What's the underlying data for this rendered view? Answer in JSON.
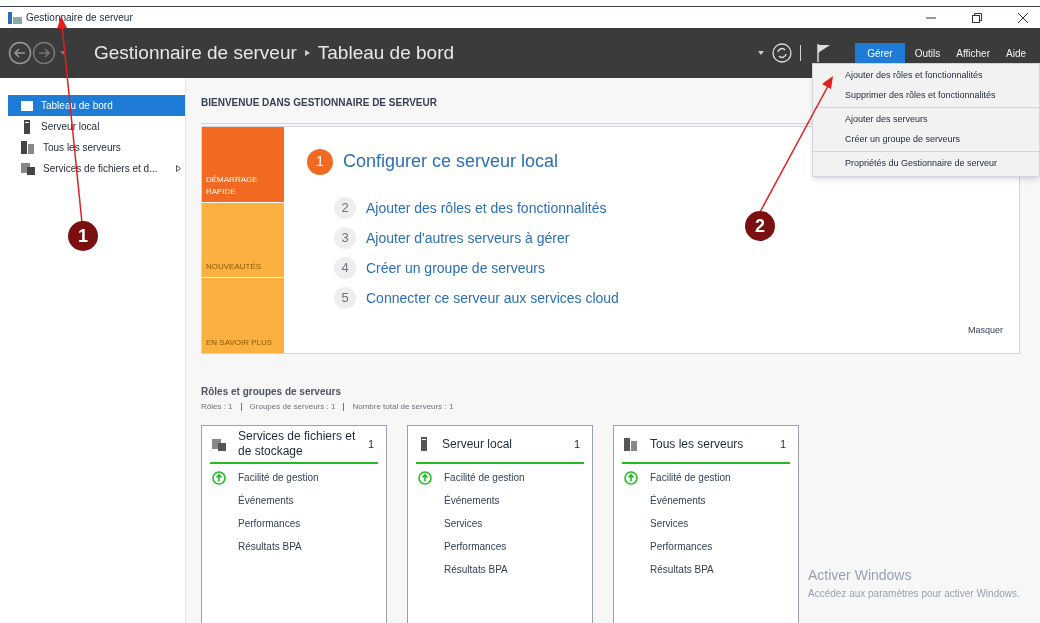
{
  "window": {
    "title": "Gestionnaire de serveur"
  },
  "header": {
    "breadcrumb": [
      "Gestionnaire de serveur",
      "Tableau de bord"
    ],
    "menus": [
      {
        "label": "Gérer",
        "selected": true
      },
      {
        "label": "Outils",
        "selected": false
      },
      {
        "label": "Afficher",
        "selected": false
      },
      {
        "label": "Aide",
        "selected": false
      }
    ]
  },
  "dropdown": {
    "groups": [
      [
        "Ajouter des rôles et fonctionnalités",
        "Supprimer des rôles et fonctionnalités"
      ],
      [
        "Ajouter des serveurs",
        "Créer un groupe de serveurs"
      ],
      [
        "Propriétés du Gestionnaire de serveur"
      ]
    ]
  },
  "sidebar": {
    "items": [
      {
        "label": "Tableau de bord",
        "selected": true,
        "kind": "dashboard",
        "expandable": false
      },
      {
        "label": "Serveur local",
        "selected": false,
        "kind": "server",
        "expandable": false
      },
      {
        "label": "Tous les serveurs",
        "selected": false,
        "kind": "servers",
        "expandable": false
      },
      {
        "label": "Services de fichiers et d...",
        "selected": false,
        "kind": "files",
        "expandable": true
      }
    ]
  },
  "welcome": {
    "heading": "BIENVENUE DANS GESTIONNAIRE DE SERVEUR",
    "tiles": [
      {
        "label": "DÉMARRAGE RAPIDE",
        "color": "#f26a21"
      },
      {
        "label": "NOUVEAUTÉS",
        "color": "#fbb040"
      },
      {
        "label": "EN SAVOIR PLUS",
        "color": "#fbb040"
      }
    ],
    "steps": [
      {
        "number": "1",
        "text": "Configurer ce serveur local",
        "kind": "primary"
      },
      {
        "number": "2",
        "text": "Ajouter des rôles et des fonctionnalités",
        "kind": "secondary"
      },
      {
        "number": "3",
        "text": "Ajouter d'autres serveurs à gérer",
        "kind": "secondary"
      },
      {
        "number": "4",
        "text": "Créer un groupe de serveurs",
        "kind": "secondary"
      },
      {
        "number": "5",
        "text": "Connecter ce serveur aux services cloud",
        "kind": "secondary"
      }
    ],
    "hide": "Masquer"
  },
  "roles": {
    "title": "Rôles et groupes de serveurs",
    "summary": [
      "Rôles : 1",
      "Groupes de serveurs : 1",
      "Nombre total de serveurs : 1"
    ],
    "cards": [
      {
        "title": "Services de fichiers et de stockage",
        "count": "1",
        "kind": "files",
        "healthy": true,
        "items": [
          "Facilité de gestion",
          "Événements",
          "Performances",
          "Résultats BPA"
        ]
      },
      {
        "title": "Serveur local",
        "count": "1",
        "kind": "server",
        "healthy": true,
        "items": [
          "Facilité de gestion",
          "Événements",
          "Services",
          "Performances",
          "Résultats BPA"
        ]
      },
      {
        "title": "Tous les serveurs",
        "count": "1",
        "kind": "servers",
        "healthy": true,
        "items": [
          "Facilité de gestion",
          "Événements",
          "Services",
          "Performances",
          "Résultats BPA"
        ]
      }
    ]
  },
  "activation": [
    "Activer Windows",
    "Accédez aux paramètres pour activer Windows."
  ],
  "annotations": [
    {
      "number": "1"
    },
    {
      "number": "2"
    }
  ]
}
